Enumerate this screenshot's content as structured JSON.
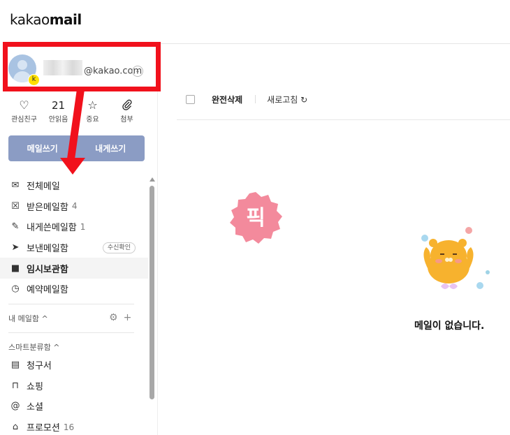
{
  "app": {
    "logo_light": "kakao",
    "logo_bold": "mail"
  },
  "account": {
    "email": "@kakao.com",
    "badge": "k"
  },
  "quick_actions": [
    {
      "icon": "heart-icon",
      "glyph": "♡",
      "count": "",
      "label": "관심친구"
    },
    {
      "icon": "",
      "glyph": "",
      "count": "21",
      "label": "안읽음"
    },
    {
      "icon": "star-icon",
      "glyph": "☆",
      "count": "",
      "label": "중요"
    },
    {
      "icon": "paperclip-icon",
      "glyph": "⊘",
      "count": "",
      "label": "첨부"
    }
  ],
  "buttons": {
    "compose": "메일쓰기",
    "to_me": "내게쓰기"
  },
  "folders": [
    {
      "label": "전체메일",
      "count": "",
      "icon": "envelope-icon",
      "glyph": "✉"
    },
    {
      "label": "받은메일함",
      "count": "4",
      "icon": "inbox-icon",
      "glyph": "☒"
    },
    {
      "label": "내게쓴메일함",
      "count": "1",
      "icon": "edit-icon",
      "glyph": "✎"
    },
    {
      "label": "보낸메일함",
      "count": "",
      "icon": "send-icon",
      "glyph": "➤",
      "pill": "수신확인"
    },
    {
      "label": "임시보관함",
      "count": "",
      "icon": "folder-icon",
      "glyph": "■",
      "selected": true
    },
    {
      "label": "예약메일함",
      "count": "",
      "icon": "clock-icon",
      "glyph": "◷"
    }
  ],
  "my_mailbox": {
    "label": "내 메일함 ^",
    "settings_glyph": "⚙",
    "add_glyph": "+"
  },
  "smart": {
    "label": "스마트분류함 ^",
    "items": [
      {
        "label": "청구서",
        "count": "",
        "icon": "receipt-icon",
        "glyph": "▤"
      },
      {
        "label": "쇼핑",
        "count": "",
        "icon": "shopping-bag-icon",
        "glyph": "⊓"
      },
      {
        "label": "소셜",
        "count": "",
        "icon": "at-icon",
        "glyph": "@"
      },
      {
        "label": "프로모션",
        "count": "16",
        "icon": "tag-icon",
        "glyph": "⌂"
      }
    ]
  },
  "toolbar": {
    "delete": "완전삭제",
    "refresh": "새로고침 ↻"
  },
  "overlay": {
    "sticker_text": "픽",
    "sticker_color": "#f38a9c",
    "annotation_color": "#f1111c"
  },
  "empty_state": {
    "message": "메일이 없습니다."
  }
}
